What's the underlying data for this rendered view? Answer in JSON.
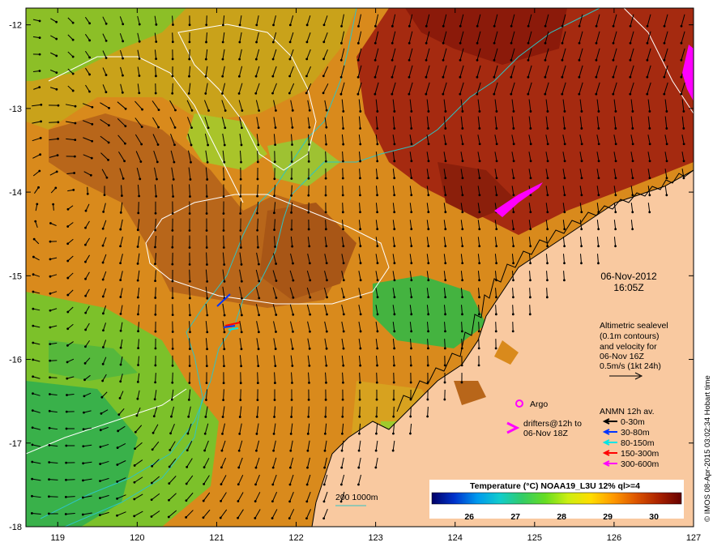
{
  "map": {
    "date": "06-Nov-2012",
    "time": "16:05Z",
    "lon_ticks": [
      "119",
      "120",
      "121",
      "122",
      "123",
      "124",
      "125",
      "126",
      "127"
    ],
    "lat_ticks": [
      "-12",
      "-13",
      "-14",
      "-15",
      "-16",
      "-17",
      "-18"
    ],
    "lon_range": [
      118.6,
      127.0
    ],
    "lat_range": [
      -11.8,
      -18.0
    ],
    "land_color": "#f9c9a0",
    "coast_color": "#000000",
    "isobath_color": "#2ec4c4",
    "contour_color": "#ffffff"
  },
  "legend": {
    "altimetry_lines": [
      "Altimetric sealevel",
      "(0.1m contours)",
      "and velocity for",
      "06-Nov 16Z",
      "0.5m/s (1kt 24h)"
    ],
    "argo_label": "Argo",
    "drifters_lines": [
      "drifters@12h to",
      "06-Nov 18Z"
    ],
    "anmn_title": "ANMN 12h av.",
    "anmn_items": [
      {
        "label": "0-30m",
        "color": "#000000"
      },
      {
        "label": "30-80m",
        "color": "#0033ff"
      },
      {
        "label": "80-150m",
        "color": "#00e5e5"
      },
      {
        "label": "150-300m",
        "color": "#ff0000"
      },
      {
        "label": "300-600m",
        "color": "#ff00ff"
      }
    ],
    "isobath_label": "200  1000m"
  },
  "colorbar": {
    "title": "Temperature (°C) NOAA19_L3U 12% ql>=4",
    "ticks": [
      "26",
      "27",
      "28",
      "29",
      "30"
    ],
    "stops": [
      "#000066",
      "#0033cc",
      "#0099ee",
      "#11cccc",
      "#33cc66",
      "#66dd22",
      "#ccee11",
      "#ffdd00",
      "#ff9900",
      "#dd5500",
      "#aa2200",
      "#660000"
    ]
  },
  "credit": "© IMOS 08-Apr-2015 03:02:34 Hobart time"
}
